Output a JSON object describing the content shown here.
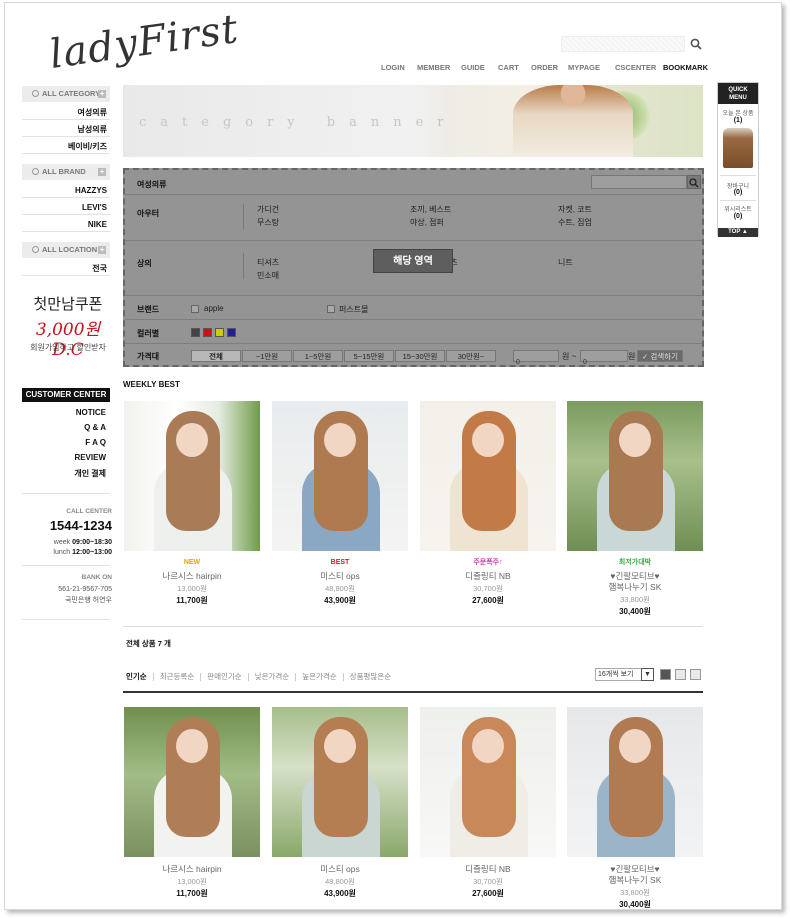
{
  "header": {
    "logo_text": "ladyFirst",
    "nav": [
      "LOGIN",
      "MEMBER",
      "GUIDE",
      "CART",
      "ORDER",
      "MYPAGE",
      "CSCENTER",
      "BOOKMARK"
    ]
  },
  "sidebar": {
    "category_head": "ALL CATEGORY",
    "categories": [
      "여성의류",
      "남성의류",
      "베이비/키즈"
    ],
    "brand_head": "ALL BRAND",
    "brands": [
      "HAZZYS",
      "LEVI'S",
      "NIKE"
    ],
    "location_head": "ALL LOCATION",
    "locations": [
      "전국"
    ],
    "coupon": {
      "line1": "첫만남쿠폰",
      "line2": "3,000원 D.C",
      "line3": "회원가입하고 할인받자"
    },
    "customer_center": {
      "head": "CUSTOMER CENTER",
      "items": [
        "NOTICE",
        "Q & A",
        "F A Q",
        "REVIEW",
        "개인 결제"
      ]
    },
    "call_center": {
      "label": "CALL CENTER",
      "phone": "1544-1234",
      "week_label": "week",
      "week_hours": "09:00~18:30",
      "lunch_label": "lunch",
      "lunch_hours": "12:00~13:00"
    },
    "bank": {
      "label": "BANK ON",
      "account": "561-21-9567-705",
      "holder": "국민은행 허연우"
    }
  },
  "banner": {
    "text": "category banner"
  },
  "filter": {
    "title": "여성의류",
    "overlay_label": "해당 영역",
    "rows": [
      {
        "label": "아우터",
        "col1": [
          "가디건",
          "무스탕"
        ],
        "col2": [
          "조끼, 베스트",
          "야상, 점퍼"
        ],
        "col3": [
          "자켓, 코트",
          "수트, 집업"
        ]
      },
      {
        "label": "상의",
        "col1": [
          "티셔츠",
          "민소매"
        ],
        "col2": [
          "셔츠"
        ],
        "col3": [
          "니트"
        ]
      }
    ],
    "brand_label": "브랜드",
    "brand_options": [
      "apple",
      "퍼스트몰"
    ],
    "color_label": "컬러별",
    "colors": [
      "#444444",
      "#cc1111",
      "#cccc00",
      "#22228a"
    ],
    "price_label": "가격대",
    "price_options": [
      "전체",
      "~1만원",
      "1~5만원",
      "5~15만원",
      "15~30만원",
      "30만원~"
    ],
    "min_price": "0",
    "max_price": "0",
    "unit_won": "원",
    "tilde": "~",
    "search_button": "검색하기"
  },
  "weekly_best": {
    "title": "WEEKLY BEST",
    "products": [
      {
        "tag": "NEW",
        "tag_color": "#e8a200",
        "name": "나르시스 hairpin",
        "old": "13,000원",
        "price": "11,700원"
      },
      {
        "tag": "BEST",
        "tag_color": "#d32020",
        "name": "미스티 ops",
        "old": "48,800원",
        "price": "43,900원"
      },
      {
        "tag": "주문폭주↑",
        "tag_color": "#cc44aa",
        "name": "디즐링티 NB",
        "old": "30,700원",
        "price": "27,600원"
      },
      {
        "tag": "최저가대박",
        "tag_color": "#3aaa44",
        "name": "♥긴팔모티브♥\n햄복나누기 SK",
        "old": "33,800원",
        "price": "30,400원"
      }
    ]
  },
  "listing": {
    "total": "전체 상품 7 개",
    "sorts": [
      "인기순",
      "최근등록순",
      "판매인기순",
      "낮은가격순",
      "높은가격순",
      "상품평많은순"
    ],
    "per_page": "16개씩 보기",
    "products": [
      {
        "name": "나르시스 hairpin",
        "old": "13,000원",
        "price": "11,700원"
      },
      {
        "name": "미스티 ops",
        "old": "48,800원",
        "price": "43,900원"
      },
      {
        "name": "디즐링티 NB",
        "old": "30,700원",
        "price": "27,600원"
      },
      {
        "name": "♥긴팔모티브♥\n햄복나누기 SK",
        "old": "33,800원",
        "price": "30,400원"
      }
    ]
  },
  "quick_menu": {
    "head_line1": "QUICK",
    "head_line2": "MENU",
    "recent_label": "오늘 본 상품",
    "recent_count": "(1)",
    "cart_label": "장바구니",
    "cart_count": "(0)",
    "wish_label": "위시리스트",
    "wish_count": "(0)",
    "top_label": "TOP ▲"
  }
}
